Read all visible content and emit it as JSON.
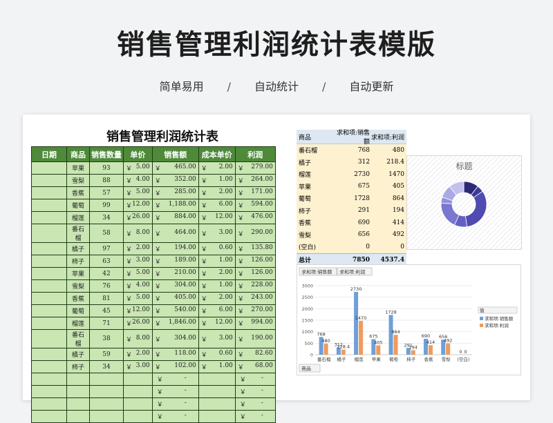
{
  "page": {
    "title": "销售管理利润统计表模版",
    "subtitle_items": [
      "简单易用",
      "/",
      "自动统计",
      "/",
      "自动更新"
    ]
  },
  "sheet": {
    "title": "销售管理利润统计表",
    "headers": [
      "日期",
      "商品",
      "销售数量",
      "单价",
      "销售额",
      "成本单价",
      "利润"
    ],
    "currency": "￥",
    "dash": "-",
    "rows": [
      {
        "date": "",
        "item": "苹果",
        "qty": "93",
        "price": "5.00",
        "sales": "465.00",
        "cost": "2.00",
        "profit": "279.00"
      },
      {
        "date": "",
        "item": "雪梨",
        "qty": "88",
        "price": "4.00",
        "sales": "352.00",
        "cost": "1.00",
        "profit": "264.00"
      },
      {
        "date": "",
        "item": "香蕉",
        "qty": "57",
        "price": "5.00",
        "sales": "285.00",
        "cost": "2.00",
        "profit": "171.00"
      },
      {
        "date": "",
        "item": "葡萄",
        "qty": "99",
        "price": "12.00",
        "sales": "1,188.00",
        "cost": "6.00",
        "profit": "594.00"
      },
      {
        "date": "",
        "item": "榴莲",
        "qty": "34",
        "price": "26.00",
        "sales": "884.00",
        "cost": "12.00",
        "profit": "476.00"
      },
      {
        "date": "",
        "item": "番石榴",
        "qty": "58",
        "price": "8.00",
        "sales": "464.00",
        "cost": "3.00",
        "profit": "290.00"
      },
      {
        "date": "",
        "item": "橘子",
        "qty": "97",
        "price": "2.00",
        "sales": "194.00",
        "cost": "0.60",
        "profit": "135.80"
      },
      {
        "date": "",
        "item": "柿子",
        "qty": "63",
        "price": "3.00",
        "sales": "189.00",
        "cost": "1.00",
        "profit": "126.00"
      },
      {
        "date": "",
        "item": "苹果",
        "qty": "42",
        "price": "5.00",
        "sales": "210.00",
        "cost": "2.00",
        "profit": "126.00"
      },
      {
        "date": "",
        "item": "雪梨",
        "qty": "76",
        "price": "4.00",
        "sales": "304.00",
        "cost": "1.00",
        "profit": "228.00"
      },
      {
        "date": "",
        "item": "香蕉",
        "qty": "81",
        "price": "5.00",
        "sales": "405.00",
        "cost": "2.00",
        "profit": "243.00"
      },
      {
        "date": "",
        "item": "葡萄",
        "qty": "45",
        "price": "12.00",
        "sales": "540.00",
        "cost": "6.00",
        "profit": "270.00"
      },
      {
        "date": "",
        "item": "榴莲",
        "qty": "71",
        "price": "26.00",
        "sales": "1,846.00",
        "cost": "12.00",
        "profit": "994.00"
      },
      {
        "date": "",
        "item": "番石榴",
        "qty": "38",
        "price": "8.00",
        "sales": "304.00",
        "cost": "3.00",
        "profit": "190.00"
      },
      {
        "date": "",
        "item": "橘子",
        "qty": "59",
        "price": "2.00",
        "sales": "118.00",
        "cost": "0.60",
        "profit": "82.60"
      },
      {
        "date": "",
        "item": "柿子",
        "qty": "34",
        "price": "3.00",
        "sales": "102.00",
        "cost": "1.00",
        "profit": "68.00"
      }
    ],
    "empty_rows": 4
  },
  "pivot": {
    "headers": [
      "商品",
      "求和项:销售额",
      "求和项:利润"
    ],
    "rows": [
      {
        "item": "番石榴",
        "sales": "768",
        "profit": "480"
      },
      {
        "item": "橘子",
        "sales": "312",
        "profit": "218.4"
      },
      {
        "item": "榴莲",
        "sales": "2730",
        "profit": "1470"
      },
      {
        "item": "苹果",
        "sales": "675",
        "profit": "405"
      },
      {
        "item": "葡萄",
        "sales": "1728",
        "profit": "864"
      },
      {
        "item": "柿子",
        "sales": "291",
        "profit": "194"
      },
      {
        "item": "香蕉",
        "sales": "690",
        "profit": "414"
      },
      {
        "item": "雪梨",
        "sales": "656",
        "profit": "492"
      },
      {
        "item": "(空白)",
        "sales": "0",
        "profit": "0"
      }
    ],
    "total": {
      "label": "总计",
      "sales": "7850",
      "profit": "4537.4"
    }
  },
  "chart_data": [
    {
      "type": "pie",
      "title": "标题",
      "categories": [
        "番石榴",
        "橘子",
        "榴莲",
        "苹果",
        "葡萄",
        "柿子",
        "香蕉",
        "雪梨",
        "(空白)"
      ],
      "values": [
        480,
        218.4,
        1470,
        405,
        864,
        194,
        414,
        492,
        0
      ],
      "colors": [
        "#2c2a78",
        "#3d3a95",
        "#4f4bb0",
        "#6360c4",
        "#7a77d0",
        "#928fdb",
        "#aaa8e5",
        "#c2c0ee",
        "#d9d8f5"
      ]
    },
    {
      "type": "bar",
      "field_buttons": [
        "求和项:销售额",
        "求和项:利润"
      ],
      "axis_button": "商品",
      "legend_title": "值",
      "legend_placement": "right",
      "categories": [
        "番石榴",
        "橘子",
        "榴莲",
        "苹果",
        "葡萄",
        "柿子",
        "香蕉",
        "雪梨",
        "(空白)"
      ],
      "series": [
        {
          "name": "求和项:销售额",
          "values": [
            768,
            312,
            2730,
            675,
            1728,
            291,
            690,
            656,
            0
          ],
          "color": "#6f9fd8"
        },
        {
          "name": "求和项:利润",
          "values": [
            480,
            218.4,
            1470,
            405,
            864,
            194,
            414,
            492,
            0
          ],
          "color": "#ee9b5c"
        }
      ],
      "ylim": [
        0,
        3000
      ],
      "yticks": [
        0,
        500,
        1000,
        1500,
        2000,
        2500,
        3000
      ]
    }
  ]
}
